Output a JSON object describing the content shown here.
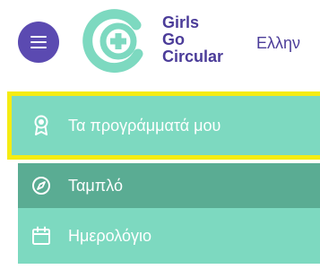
{
  "header": {
    "menu_icon": "hamburger-menu-icon",
    "logo": {
      "line1": "Girls",
      "line2": "Go",
      "line3": "Circular",
      "mark_color": "#7dd9c0",
      "text_color": "#4b3c99"
    },
    "language_label": "Ελλην"
  },
  "nav": {
    "items": [
      {
        "label": "Τα προγράμματά μου",
        "icon": "award-ribbon-icon",
        "highlighted": true
      },
      {
        "label": "Ταμπλό",
        "icon": "compass-icon",
        "active": true
      },
      {
        "label": "Ημερολόγιο",
        "icon": "calendar-icon"
      }
    ]
  },
  "colors": {
    "menu_button": "#5b4ab1",
    "nav_background": "#7dd9c0",
    "nav_active": "#5aac93",
    "highlight_border": "#f5ec12"
  }
}
